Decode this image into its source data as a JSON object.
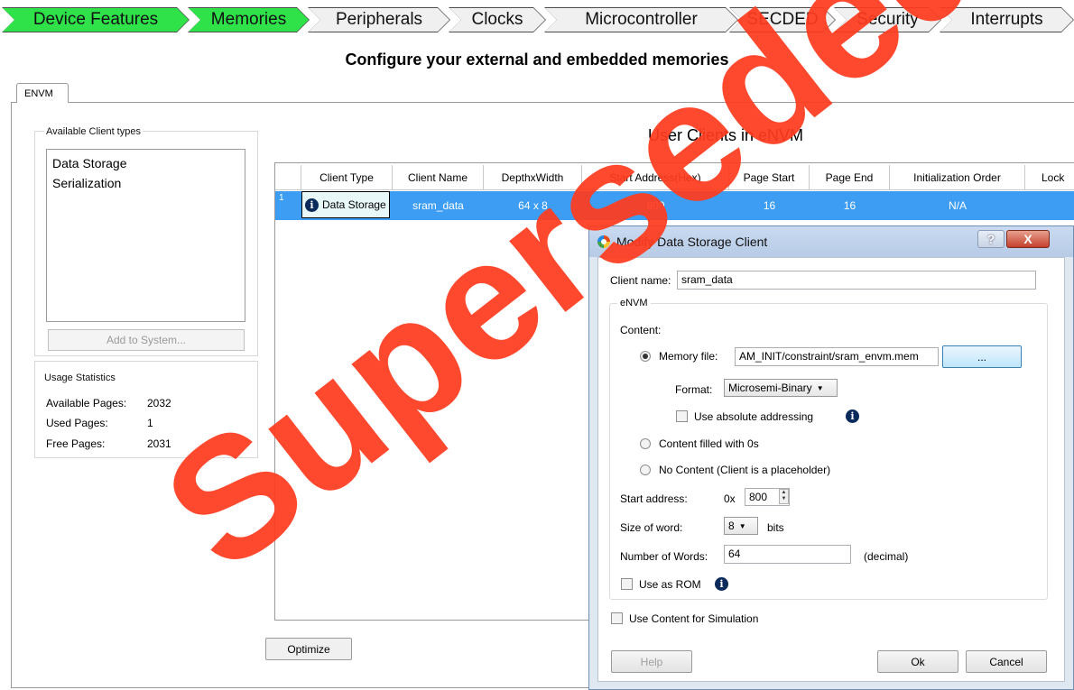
{
  "steps": [
    {
      "label": "Device Features",
      "active": true
    },
    {
      "label": "Memories",
      "active": true
    },
    {
      "label": "Peripherals",
      "active": false
    },
    {
      "label": "Clocks",
      "active": false
    },
    {
      "label": "Microcontroller",
      "active": false
    },
    {
      "label": "SECDED",
      "active": false
    },
    {
      "label": "Security",
      "active": false
    },
    {
      "label": "Interrupts",
      "active": false
    }
  ],
  "page_title": "Configure your external and embedded memories",
  "tab_label": "ENVM",
  "available_clients": {
    "title": "Available Client types",
    "items": [
      "Data Storage",
      "Serialization"
    ],
    "add_button": "Add to System..."
  },
  "usage": {
    "title": "Usage Statistics",
    "available_label": "Available Pages:",
    "available_value": "2032",
    "used_label": "Used Pages:",
    "used_value": "1",
    "free_label": "Free Pages:",
    "free_value": "2031"
  },
  "user_clients": {
    "title": "User Clients in eNVM",
    "columns": [
      "Client Type",
      "Client Name",
      "DepthxWidth",
      "Start Address(Hex)",
      "Page Start",
      "Page End",
      "Initialization Order",
      "Lock"
    ],
    "row": {
      "index": "1",
      "client_type": "Data Storage",
      "client_name": "sram_data",
      "depth_width": "64 x 8",
      "start_address": "800",
      "page_start": "16",
      "page_end": "16",
      "init_order": "N/A"
    },
    "selected_color": "#3d9df2",
    "optimize_button": "Optimize"
  },
  "dialog": {
    "title": "Modify Data Storage Client",
    "help_glyph": "?",
    "close_glyph": "X",
    "client_name_label": "Client name:",
    "client_name_value": "sram_data",
    "envm_group": "eNVM",
    "content_label": "Content:",
    "memory_file_label": "Memory file:",
    "memory_file_value": "AM_INIT/constraint/sram_envm.mem",
    "browse_button": "...",
    "format_label": "Format:",
    "format_value": "Microsemi-Binary",
    "absolute_label": "Use absolute addressing",
    "zeros_label": "Content filled with 0s",
    "no_content_label": "No Content (Client is a placeholder)",
    "start_address_label": "Start address:",
    "start_address_prefix": "0x",
    "start_address_value": "800",
    "word_size_label": "Size of word:",
    "word_size_value": "8",
    "word_size_unit": "bits",
    "num_words_label": "Number of Words:",
    "num_words_value": "64",
    "num_words_unit": "(decimal)",
    "rom_label": "Use as ROM",
    "simulation_label": "Use Content for Simulation",
    "help_button": "Help",
    "ok_button": "Ok",
    "cancel_button": "Cancel"
  },
  "watermark": {
    "text": "Superseded",
    "color": "#ff3b1f"
  },
  "colors": {
    "step_active": "#2fe24a",
    "step_inactive": "#f0f0f0",
    "info_icon": "#0a2a5c"
  }
}
